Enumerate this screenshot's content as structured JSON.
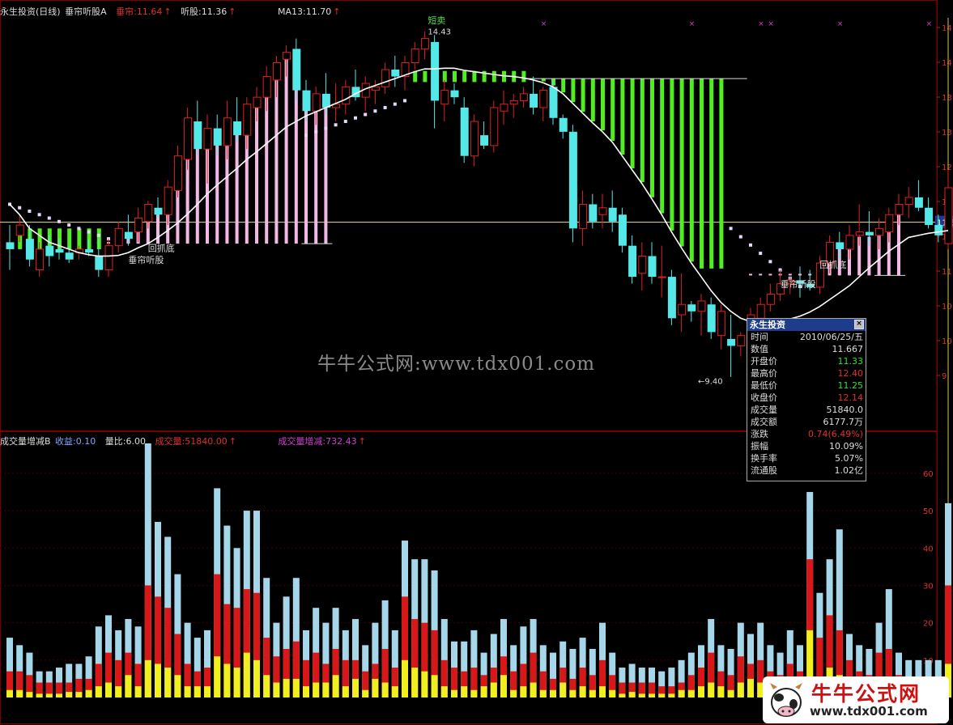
{
  "header": {
    "title": "永生投资(日线)",
    "indicator": "垂帘听股A",
    "chui_label": "垂帘:",
    "chui_value": "11.64",
    "ting_label": "听股:",
    "ting_value": "11.36",
    "ma_label": "MA13:",
    "ma_value": "11.70"
  },
  "sub_header": {
    "name": "成交量增减B",
    "shouyi_label": "收益:",
    "shouyi_value": "0.10",
    "liangbi_label": "量比:",
    "liangbi_value": "6.00",
    "vol_label": "成交量:",
    "vol_value": "51840.00",
    "zengjian_label": "成交量增减:",
    "zengjian_value": "732.43"
  },
  "annotations": {
    "duanmai": "短卖",
    "high_price": "14.43",
    "low_price": "9.40",
    "bottom1": "回抓底",
    "signal1": "垂帘听股",
    "bottom2": "回抓底",
    "signal2": "垂帘听股",
    "current_price_tag": "11.6"
  },
  "info_box": {
    "title": "永生投资",
    "close_symbol": "×",
    "rows": [
      {
        "k": "时间",
        "v": "2010/06/25/五"
      },
      {
        "k": "数值",
        "v": "11.667"
      },
      {
        "k": "开盘价",
        "v": "11.33"
      },
      {
        "k": "最高价",
        "v": "12.40"
      },
      {
        "k": "最低价",
        "v": "11.25"
      },
      {
        "k": "收盘价",
        "v": "12.14"
      },
      {
        "k": "成交量",
        "v": "51840.0"
      },
      {
        "k": "成交额",
        "v": "6177.7万"
      },
      {
        "k": "涨跌",
        "v": "0.74(6.49%)"
      },
      {
        "k": "振幅",
        "v": "10.09%"
      },
      {
        "k": "换手率",
        "v": "5.07%"
      },
      {
        "k": "流通股",
        "v": "1.02亿"
      }
    ]
  },
  "watermark": {
    "text": "牛牛公式网:www.tdx001.com",
    "logo_title": "牛牛公式网",
    "logo_url": "www.tdx001.com"
  },
  "axis": {
    "price_ticks": [
      "14",
      "14",
      "13",
      "13",
      "12",
      "12",
      "11",
      "11",
      "10",
      "10",
      "9"
    ],
    "volume_ticks": [
      "60",
      "50",
      "40",
      "30",
      "20",
      "10"
    ]
  },
  "colors": {
    "up": "#e02020",
    "down": "#54e8e8",
    "ma": "#ffffff",
    "pink": "#f4b8e6",
    "green": "#50ee20",
    "vol_blue": "#a6d6ea",
    "vol_red": "#d81818",
    "vol_yellow": "#f0f020",
    "grid": "#7a0000"
  },
  "chart_data": {
    "type": "candlestick",
    "price_range": [
      9.0,
      14.6
    ],
    "volume_range": [
      0,
      68
    ],
    "candles": [
      {
        "o": 11.35,
        "h": 11.6,
        "l": 10.95,
        "c": 11.25
      },
      {
        "o": 11.45,
        "h": 11.75,
        "l": 11.35,
        "c": 11.6
      },
      {
        "o": 11.4,
        "h": 11.6,
        "l": 11.0,
        "c": 11.1
      },
      {
        "o": 10.95,
        "h": 11.35,
        "l": 10.85,
        "c": 11.25
      },
      {
        "o": 11.3,
        "h": 11.45,
        "l": 11.0,
        "c": 11.15
      },
      {
        "o": 11.25,
        "h": 11.4,
        "l": 11.1,
        "c": 11.2
      },
      {
        "o": 11.2,
        "h": 11.3,
        "l": 11.05,
        "c": 11.1
      },
      {
        "o": 11.2,
        "h": 11.3,
        "l": 11.1,
        "c": 11.25
      },
      {
        "o": 11.25,
        "h": 11.4,
        "l": 11.15,
        "c": 11.2
      },
      {
        "o": 11.15,
        "h": 11.4,
        "l": 10.85,
        "c": 10.95
      },
      {
        "o": 10.95,
        "h": 11.4,
        "l": 10.85,
        "c": 11.3
      },
      {
        "o": 11.3,
        "h": 11.65,
        "l": 11.2,
        "c": 11.55
      },
      {
        "o": 11.5,
        "h": 11.75,
        "l": 11.3,
        "c": 11.4
      },
      {
        "o": 11.5,
        "h": 11.85,
        "l": 11.35,
        "c": 11.7
      },
      {
        "o": 11.65,
        "h": 11.95,
        "l": 11.55,
        "c": 11.9
      },
      {
        "o": 11.85,
        "h": 12.0,
        "l": 11.7,
        "c": 11.75
      },
      {
        "o": 11.75,
        "h": 12.25,
        "l": 11.6,
        "c": 12.15
      },
      {
        "o": 12.1,
        "h": 12.75,
        "l": 12.0,
        "c": 12.6
      },
      {
        "o": 12.55,
        "h": 13.3,
        "l": 12.4,
        "c": 13.15
      },
      {
        "o": 13.1,
        "h": 13.4,
        "l": 12.6,
        "c": 12.7
      },
      {
        "o": 12.7,
        "h": 13.2,
        "l": 12.2,
        "c": 13.0
      },
      {
        "o": 13.0,
        "h": 13.2,
        "l": 12.6,
        "c": 12.75
      },
      {
        "o": 12.75,
        "h": 13.4,
        "l": 12.55,
        "c": 13.15
      },
      {
        "o": 13.1,
        "h": 13.45,
        "l": 12.8,
        "c": 12.9
      },
      {
        "o": 12.9,
        "h": 13.45,
        "l": 12.7,
        "c": 13.35
      },
      {
        "o": 13.3,
        "h": 13.6,
        "l": 13.1,
        "c": 13.45
      },
      {
        "o": 13.45,
        "h": 13.9,
        "l": 13.25,
        "c": 13.75
      },
      {
        "o": 13.7,
        "h": 14.05,
        "l": 13.45,
        "c": 13.95
      },
      {
        "o": 14.0,
        "h": 14.2,
        "l": 13.75,
        "c": 14.1
      },
      {
        "o": 14.15,
        "h": 14.3,
        "l": 13.4,
        "c": 13.55
      },
      {
        "o": 13.55,
        "h": 13.7,
        "l": 13.1,
        "c": 13.25
      },
      {
        "o": 13.25,
        "h": 13.6,
        "l": 13.05,
        "c": 13.5
      },
      {
        "o": 13.5,
        "h": 13.8,
        "l": 13.2,
        "c": 13.3
      },
      {
        "o": 13.3,
        "h": 13.65,
        "l": 13.1,
        "c": 13.35
      },
      {
        "o": 13.35,
        "h": 13.7,
        "l": 13.2,
        "c": 13.6
      },
      {
        "o": 13.6,
        "h": 13.85,
        "l": 13.4,
        "c": 13.45
      },
      {
        "o": 13.45,
        "h": 13.75,
        "l": 13.25,
        "c": 13.65
      },
      {
        "o": 13.55,
        "h": 13.7,
        "l": 13.35,
        "c": 13.6
      },
      {
        "o": 13.6,
        "h": 13.95,
        "l": 13.5,
        "c": 13.85
      },
      {
        "o": 13.85,
        "h": 14.05,
        "l": 13.6,
        "c": 13.75
      },
      {
        "o": 13.75,
        "h": 14.05,
        "l": 13.55,
        "c": 13.95
      },
      {
        "o": 13.95,
        "h": 14.25,
        "l": 13.85,
        "c": 14.15
      },
      {
        "o": 14.15,
        "h": 14.4,
        "l": 14.0,
        "c": 14.3
      },
      {
        "o": 14.25,
        "h": 14.35,
        "l": 13.0,
        "c": 13.4
      },
      {
        "o": 13.35,
        "h": 13.7,
        "l": 13.1,
        "c": 13.55
      },
      {
        "o": 13.55,
        "h": 13.65,
        "l": 13.35,
        "c": 13.45
      },
      {
        "o": 13.3,
        "h": 13.45,
        "l": 12.5,
        "c": 12.6
      },
      {
        "o": 12.6,
        "h": 13.2,
        "l": 12.45,
        "c": 13.1
      },
      {
        "o": 12.9,
        "h": 13.1,
        "l": 12.7,
        "c": 12.75
      },
      {
        "o": 12.75,
        "h": 13.4,
        "l": 12.65,
        "c": 13.3
      },
      {
        "o": 13.25,
        "h": 13.55,
        "l": 13.05,
        "c": 13.35
      },
      {
        "o": 13.35,
        "h": 13.5,
        "l": 13.15,
        "c": 13.4
      },
      {
        "o": 13.4,
        "h": 13.6,
        "l": 13.3,
        "c": 13.5
      },
      {
        "o": 13.5,
        "h": 13.75,
        "l": 13.2,
        "c": 13.3
      },
      {
        "o": 13.3,
        "h": 13.6,
        "l": 13.1,
        "c": 13.55
      },
      {
        "o": 13.6,
        "h": 13.7,
        "l": 13.05,
        "c": 13.15
      },
      {
        "o": 13.15,
        "h": 13.2,
        "l": 12.85,
        "c": 12.95
      },
      {
        "o": 12.95,
        "h": 13.05,
        "l": 11.35,
        "c": 11.55
      },
      {
        "o": 11.55,
        "h": 12.1,
        "l": 11.3,
        "c": 11.9
      },
      {
        "o": 11.9,
        "h": 12.05,
        "l": 11.55,
        "c": 11.65
      },
      {
        "o": 11.75,
        "h": 12.05,
        "l": 11.55,
        "c": 11.85
      },
      {
        "o": 11.85,
        "h": 12.1,
        "l": 11.5,
        "c": 11.65
      },
      {
        "o": 11.75,
        "h": 11.85,
        "l": 11.2,
        "c": 11.3
      },
      {
        "o": 11.3,
        "h": 11.45,
        "l": 10.75,
        "c": 10.85
      },
      {
        "o": 10.9,
        "h": 11.35,
        "l": 10.65,
        "c": 11.15
      },
      {
        "o": 11.15,
        "h": 11.35,
        "l": 10.75,
        "c": 10.85
      },
      {
        "o": 10.85,
        "h": 11.3,
        "l": 10.55,
        "c": 10.85
      },
      {
        "o": 10.85,
        "h": 10.95,
        "l": 10.15,
        "c": 10.25
      },
      {
        "o": 10.3,
        "h": 10.9,
        "l": 10.05,
        "c": 10.45
      },
      {
        "o": 10.45,
        "h": 10.5,
        "l": 10.2,
        "c": 10.35
      },
      {
        "o": 10.35,
        "h": 10.6,
        "l": 10.0,
        "c": 10.5
      },
      {
        "o": 10.45,
        "h": 10.55,
        "l": 9.95,
        "c": 10.05
      },
      {
        "o": 10.0,
        "h": 10.45,
        "l": 9.8,
        "c": 10.35
      },
      {
        "o": 9.95,
        "h": 10.3,
        "l": 9.4,
        "c": 9.85
      },
      {
        "o": 9.85,
        "h": 10.05,
        "l": 9.7,
        "c": 10.0
      },
      {
        "o": 10.0,
        "h": 10.4,
        "l": 9.95,
        "c": 10.3
      },
      {
        "o": 10.25,
        "h": 10.55,
        "l": 10.15,
        "c": 10.45
      },
      {
        "o": 10.45,
        "h": 10.75,
        "l": 10.35,
        "c": 10.6
      },
      {
        "o": 10.6,
        "h": 10.95,
        "l": 10.5,
        "c": 10.75
      },
      {
        "o": 10.75,
        "h": 10.85,
        "l": 10.6,
        "c": 10.8
      },
      {
        "o": 10.8,
        "h": 11.0,
        "l": 10.55,
        "c": 10.75
      },
      {
        "o": 10.75,
        "h": 10.95,
        "l": 10.65,
        "c": 10.7
      },
      {
        "o": 10.7,
        "h": 11.15,
        "l": 10.6,
        "c": 11.05
      },
      {
        "o": 11.05,
        "h": 11.45,
        "l": 10.9,
        "c": 11.35
      },
      {
        "o": 11.35,
        "h": 11.5,
        "l": 11.1,
        "c": 11.25
      },
      {
        "o": 11.25,
        "h": 11.6,
        "l": 11.1,
        "c": 11.45
      },
      {
        "o": 11.45,
        "h": 11.9,
        "l": 11.3,
        "c": 11.5
      },
      {
        "o": 11.5,
        "h": 11.8,
        "l": 11.3,
        "c": 11.45
      },
      {
        "o": 11.45,
        "h": 11.7,
        "l": 11.25,
        "c": 11.55
      },
      {
        "o": 11.5,
        "h": 11.85,
        "l": 11.35,
        "c": 11.75
      },
      {
        "o": 11.75,
        "h": 12.05,
        "l": 11.6,
        "c": 11.9
      },
      {
        "o": 11.9,
        "h": 12.15,
        "l": 11.7,
        "c": 12.0
      },
      {
        "o": 12.0,
        "h": 12.25,
        "l": 11.8,
        "c": 11.85
      },
      {
        "o": 11.85,
        "h": 12.0,
        "l": 11.55,
        "c": 11.6
      },
      {
        "o": 11.6,
        "h": 11.75,
        "l": 11.35,
        "c": 11.45
      },
      {
        "o": 11.33,
        "h": 12.4,
        "l": 11.25,
        "c": 12.14
      }
    ],
    "ma13": [
      11.9,
      11.75,
      11.55,
      11.45,
      11.35,
      11.3,
      11.25,
      11.2,
      11.17,
      11.15,
      11.15,
      11.16,
      11.2,
      11.27,
      11.33,
      11.42,
      11.52,
      11.63,
      11.76,
      11.9,
      12.05,
      12.18,
      12.3,
      12.42,
      12.55,
      12.66,
      12.78,
      12.9,
      13.02,
      13.1,
      13.18,
      13.24,
      13.3,
      13.36,
      13.42,
      13.5,
      13.57,
      13.62,
      13.67,
      13.72,
      13.77,
      13.82,
      13.86,
      13.86,
      13.87,
      13.87,
      13.84,
      13.82,
      13.8,
      13.78,
      13.76,
      13.75,
      13.73,
      13.7,
      13.66,
      13.6,
      13.5,
      13.36,
      13.22,
      13.08,
      12.95,
      12.8,
      12.6,
      12.4,
      12.2,
      11.98,
      11.75,
      11.5,
      11.27,
      11.05,
      10.85,
      10.65,
      10.48,
      10.35,
      10.25,
      10.2,
      10.18,
      10.18,
      10.2,
      10.24,
      10.28,
      10.34,
      10.42,
      10.52,
      10.62,
      10.72,
      10.85,
      10.98,
      11.1,
      11.22,
      11.32,
      11.42,
      11.45,
      11.48,
      11.5,
      11.52
    ],
    "volume": [
      {
        "t": 16,
        "m": 7,
        "y": 2
      },
      {
        "t": 14,
        "m": 7,
        "y": 2
      },
      {
        "t": 12,
        "m": 6,
        "y": 1.5
      },
      {
        "t": 7,
        "m": 4,
        "y": 1
      },
      {
        "t": 7,
        "m": 4,
        "y": 1
      },
      {
        "t": 8,
        "m": 4,
        "y": 1
      },
      {
        "t": 9,
        "m": 4,
        "y": 1.5
      },
      {
        "t": 9,
        "m": 5,
        "y": 1.5
      },
      {
        "t": 11,
        "m": 5,
        "y": 2
      },
      {
        "t": 19,
        "m": 9,
        "y": 3
      },
      {
        "t": 22,
        "m": 12,
        "y": 4
      },
      {
        "t": 18,
        "m": 10,
        "y": 3
      },
      {
        "t": 21,
        "m": 12,
        "y": 6
      },
      {
        "t": 19,
        "m": 9,
        "y": 3
      },
      {
        "t": 68,
        "m": 30,
        "y": 10
      },
      {
        "t": 47,
        "m": 27,
        "y": 9
      },
      {
        "t": 43,
        "m": 24,
        "y": 8
      },
      {
        "t": 33,
        "m": 17,
        "y": 6
      },
      {
        "t": 20,
        "m": 9,
        "y": 3
      },
      {
        "t": 16,
        "m": 7,
        "y": 3
      },
      {
        "t": 18,
        "m": 8,
        "y": 3
      },
      {
        "t": 56,
        "m": 33,
        "y": 11
      },
      {
        "t": 46,
        "m": 25,
        "y": 9
      },
      {
        "t": 40,
        "m": 24,
        "y": 8
      },
      {
        "t": 50,
        "m": 29,
        "y": 12
      },
      {
        "t": 50,
        "m": 28,
        "y": 10
      },
      {
        "t": 32,
        "m": 16,
        "y": 6
      },
      {
        "t": 20,
        "m": 11,
        "y": 4
      },
      {
        "t": 27,
        "m": 13,
        "y": 5
      },
      {
        "t": 32,
        "m": 15,
        "y": 5
      },
      {
        "t": 18,
        "m": 10,
        "y": 3
      },
      {
        "t": 24,
        "m": 12,
        "y": 4
      },
      {
        "t": 20,
        "m": 9,
        "y": 4
      },
      {
        "t": 24,
        "m": 13,
        "y": 6
      },
      {
        "t": 18,
        "m": 10,
        "y": 3
      },
      {
        "t": 21,
        "m": 10,
        "y": 5
      },
      {
        "t": 14,
        "m": 7,
        "y": 2
      },
      {
        "t": 20,
        "m": 9,
        "y": 5
      },
      {
        "t": 26,
        "m": 13,
        "y": 4
      },
      {
        "t": 18,
        "m": 8,
        "y": 3
      },
      {
        "t": 42,
        "m": 27,
        "y": 10
      },
      {
        "t": 37,
        "m": 21,
        "y": 8
      },
      {
        "t": 37,
        "m": 20,
        "y": 7
      },
      {
        "t": 34,
        "m": 18,
        "y": 6
      },
      {
        "t": 21,
        "m": 10,
        "y": 3
      },
      {
        "t": 15,
        "m": 8,
        "y": 2
      },
      {
        "t": 15,
        "m": 7,
        "y": 3
      },
      {
        "t": 18,
        "m": 8,
        "y": 2
      },
      {
        "t": 12,
        "m": 6,
        "y": 3
      },
      {
        "t": 17,
        "m": 8,
        "y": 4
      },
      {
        "t": 21,
        "m": 11,
        "y": 6
      },
      {
        "t": 14,
        "m": 7,
        "y": 2
      },
      {
        "t": 19,
        "m": 9,
        "y": 3
      },
      {
        "t": 21,
        "m": 12,
        "y": 4
      },
      {
        "t": 14,
        "m": 7,
        "y": 2
      },
      {
        "t": 12,
        "m": 5,
        "y": 2
      },
      {
        "t": 15,
        "m": 8,
        "y": 4
      },
      {
        "t": 13,
        "m": 5,
        "y": 2
      },
      {
        "t": 16,
        "m": 8,
        "y": 3
      },
      {
        "t": 13,
        "m": 6,
        "y": 2
      },
      {
        "t": 20,
        "m": 10,
        "y": 3
      },
      {
        "t": 12,
        "m": 6,
        "y": 2
      },
      {
        "t": 8,
        "m": 4,
        "y": 1
      },
      {
        "t": 9,
        "m": 4,
        "y": 1.5
      },
      {
        "t": 8,
        "m": 4,
        "y": 1
      },
      {
        "t": 8,
        "m": 4,
        "y": 1
      },
      {
        "t": 7,
        "m": 3,
        "y": 1
      },
      {
        "t": 8,
        "m": 3,
        "y": 1
      },
      {
        "t": 10,
        "m": 4,
        "y": 2
      },
      {
        "t": 12,
        "m": 6,
        "y": 2
      },
      {
        "t": 14,
        "m": 8,
        "y": 3
      },
      {
        "t": 21,
        "m": 12,
        "y": 4
      },
      {
        "t": 14,
        "m": 7,
        "y": 3
      },
      {
        "t": 13,
        "m": 6,
        "y": 2
      },
      {
        "t": 20,
        "m": 11,
        "y": 4
      },
      {
        "t": 17,
        "m": 9,
        "y": 5
      },
      {
        "t": 20,
        "m": 10,
        "y": 4
      },
      {
        "t": 14,
        "m": 7,
        "y": 3
      },
      {
        "t": 12,
        "m": 6,
        "y": 2
      },
      {
        "t": 18,
        "m": 9,
        "y": 4
      },
      {
        "t": 14,
        "m": 7,
        "y": 2
      },
      {
        "t": 55,
        "m": 37,
        "y": 18
      },
      {
        "t": 28,
        "m": 16,
        "y": 5
      },
      {
        "t": 37,
        "m": 22,
        "y": 8
      },
      {
        "t": 45,
        "m": 18,
        "y": 6
      },
      {
        "t": 17,
        "m": 10,
        "y": 3
      },
      {
        "t": 14,
        "m": 7,
        "y": 2
      },
      {
        "t": 13,
        "m": 6,
        "y": 1
      },
      {
        "t": 20,
        "m": 12,
        "y": 3
      },
      {
        "t": 29,
        "m": 13,
        "y": 4
      },
      {
        "t": 12,
        "m": 6,
        "y": 1
      },
      {
        "t": 10,
        "m": 5,
        "y": 1
      },
      {
        "t": 10,
        "m": 5,
        "y": 1
      },
      {
        "t": 10,
        "m": 5,
        "y": 1
      },
      {
        "t": 10,
        "m": 5,
        "y": 1
      },
      {
        "t": 52,
        "m": 30,
        "y": 9
      }
    ]
  }
}
